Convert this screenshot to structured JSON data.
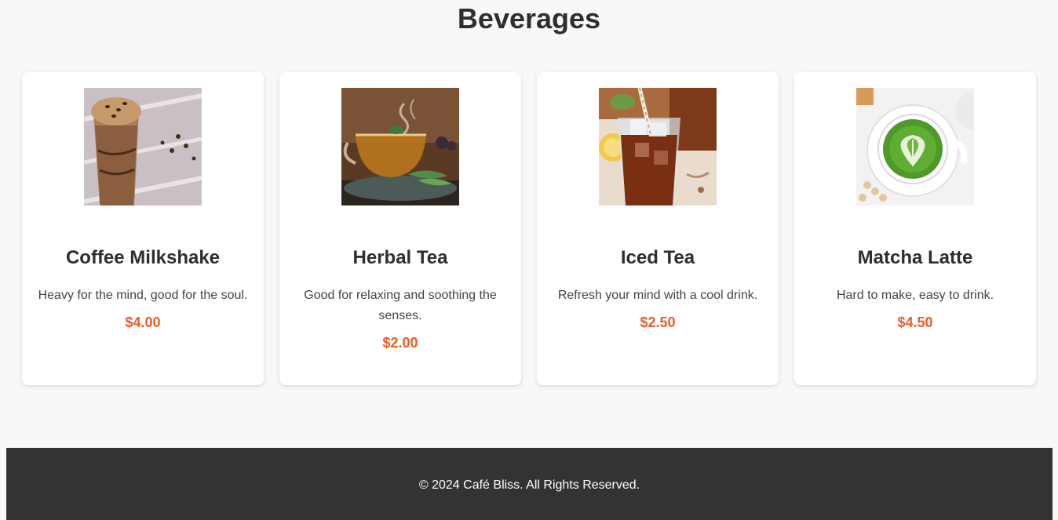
{
  "section": {
    "title": "Beverages"
  },
  "items": [
    {
      "name": "Coffee Milkshake",
      "description": "Heavy for the mind, good for the soul.",
      "price": "$4.00",
      "image_icon": "coffee-milkshake-photo"
    },
    {
      "name": "Herbal Tea",
      "description": "Good for relaxing and soothing the senses.",
      "price": "$2.00",
      "image_icon": "herbal-tea-photo"
    },
    {
      "name": "Iced Tea",
      "description": "Refresh your mind with a cool drink.",
      "price": "$2.50",
      "image_icon": "iced-tea-photo"
    },
    {
      "name": "Matcha Latte",
      "description": "Hard to make, easy to drink.",
      "price": "$4.50",
      "image_icon": "matcha-latte-photo"
    }
  ],
  "footer": {
    "text": "© 2024 Café Bliss. All Rights Reserved."
  },
  "colors": {
    "price": "#f05a28",
    "footer_bg": "#333333",
    "page_bg": "#f8f8f8"
  }
}
